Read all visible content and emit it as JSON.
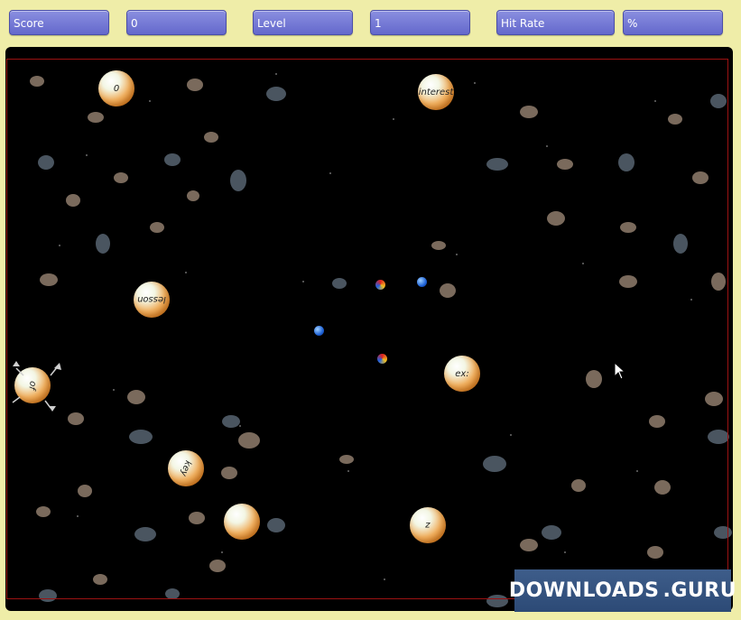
{
  "hud": {
    "score_label": "Score",
    "score_value": "0",
    "level_label": "Level",
    "level_value": "1",
    "hit_rate_label": "Hit Rate",
    "hit_rate_value": "%"
  },
  "balls": [
    {
      "text": "0"
    },
    {
      "text": "interest"
    },
    {
      "text": "lesson"
    },
    {
      "text": "ex:"
    },
    {
      "text": "of"
    },
    {
      "text": "key"
    },
    {
      "text": ""
    },
    {
      "text": "z"
    }
  ],
  "watermark": {
    "text": "DOWNLOADS",
    "suffix": ".GURU"
  },
  "colors": {
    "background": "#efeda8",
    "hud_button": "#7479d8",
    "field": "#000000",
    "field_border": "#9c1212",
    "ball_orange": "#e08a2a"
  }
}
